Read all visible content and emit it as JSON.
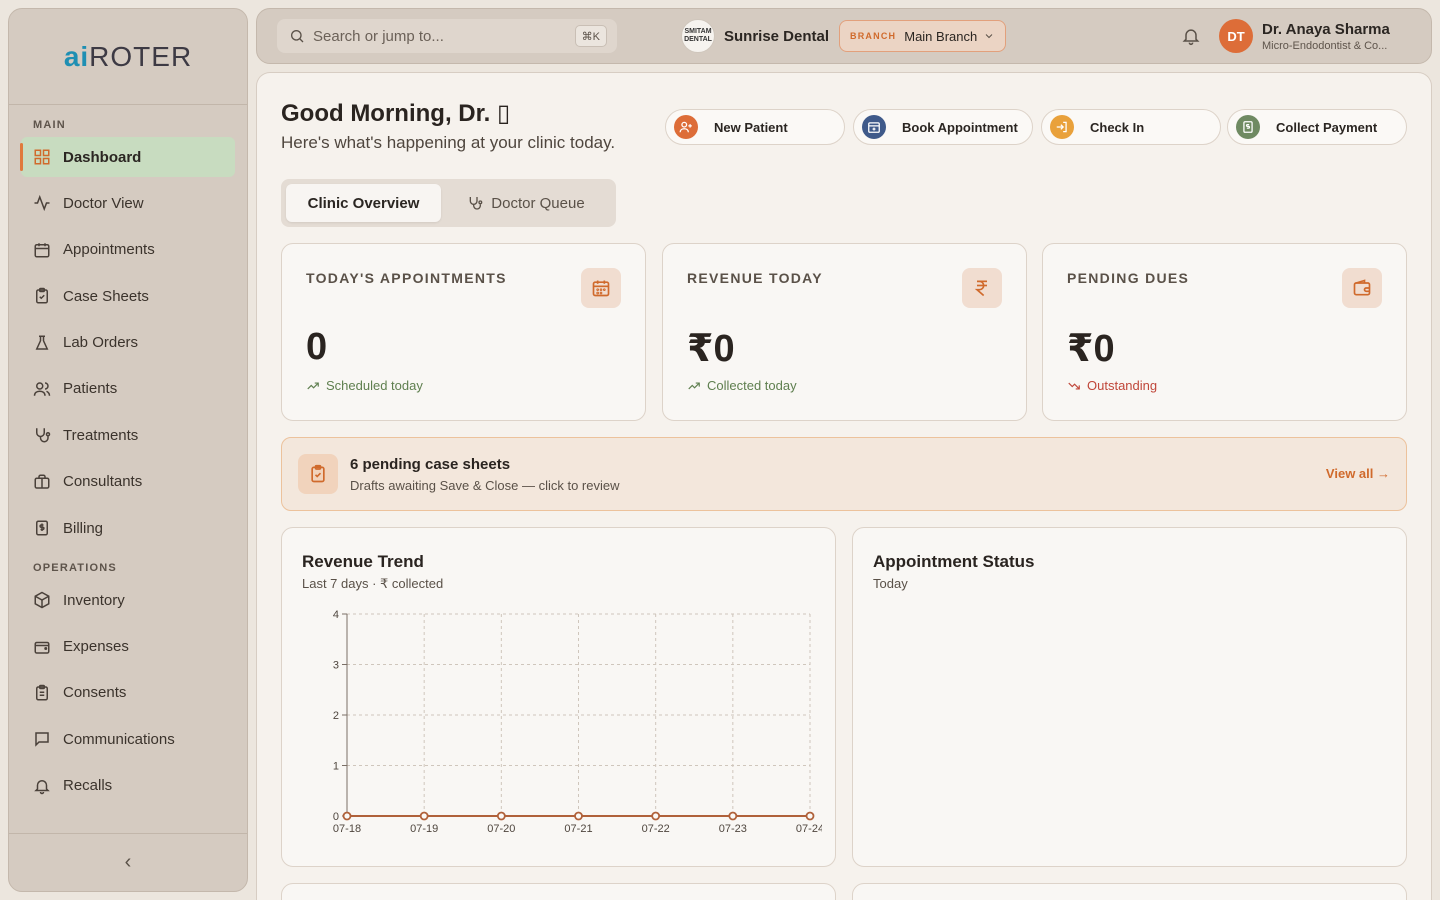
{
  "app": {
    "logo_ai": "ai",
    "logo_rest": "ROTER"
  },
  "sidebar": {
    "section_main": "MAIN",
    "section_ops": "OPERATIONS",
    "items": [
      {
        "label": "Dashboard",
        "icon": "dashboard-icon"
      },
      {
        "label": "Doctor View",
        "icon": "activity-icon"
      },
      {
        "label": "Appointments",
        "icon": "calendar-icon"
      },
      {
        "label": "Case Sheets",
        "icon": "clipboard-icon"
      },
      {
        "label": "Lab Orders",
        "icon": "flask-icon"
      },
      {
        "label": "Patients",
        "icon": "users-icon"
      },
      {
        "label": "Treatments",
        "icon": "stethoscope-icon"
      },
      {
        "label": "Consultants",
        "icon": "briefcase-icon"
      },
      {
        "label": "Billing",
        "icon": "receipt-icon"
      }
    ],
    "ops_items": [
      {
        "label": "Inventory",
        "icon": "package-icon"
      },
      {
        "label": "Expenses",
        "icon": "wallet-icon"
      },
      {
        "label": "Consents",
        "icon": "clipboard-list-icon"
      },
      {
        "label": "Communications",
        "icon": "message-icon"
      },
      {
        "label": "Recalls",
        "icon": "bell-icon"
      }
    ],
    "collapse_glyph": "‹"
  },
  "topbar": {
    "search_placeholder": "Search or jump to...",
    "shortcut": "⌘K",
    "clinic_logo_text": "SMITAM DENTAL",
    "clinic_name": "Sunrise Dental",
    "branch_tag": "BRANCH",
    "branch_name": "Main Branch",
    "avatar_initials": "DT",
    "user_name": "Dr. Anaya Sharma",
    "user_role": "Micro-Endodontist & Co..."
  },
  "main": {
    "greeting": "Good Morning, Dr. ▯",
    "subtitle": "Here's what's happening at your clinic today.",
    "quick_actions": [
      {
        "label": "New Patient",
        "icon": "user-plus-icon",
        "color": "#dd6d38"
      },
      {
        "label": "Book Appointment",
        "icon": "calendar-plus-icon",
        "color": "#3f5a8a"
      },
      {
        "label": "Check In",
        "icon": "login-icon",
        "color": "#e9a13b"
      },
      {
        "label": "Collect Payment",
        "icon": "receipt-icon",
        "color": "#6f8a62"
      }
    ],
    "tabs": [
      {
        "label": "Clinic Overview"
      },
      {
        "label": "Doctor Queue"
      }
    ],
    "stats": [
      {
        "title": "TODAY'S APPOINTMENTS",
        "value": "0",
        "foot": "Scheduled today",
        "trend": "up",
        "icon": "calendar-icon"
      },
      {
        "title": "REVENUE TODAY",
        "value": "₹0",
        "foot": "Collected today",
        "trend": "up",
        "icon": "rupee-icon"
      },
      {
        "title": "PENDING DUES",
        "value": "₹0",
        "foot": "Outstanding",
        "trend": "down",
        "icon": "wallet-icon"
      }
    ],
    "banner": {
      "title": "6 pending case sheets",
      "subtitle": "Drafts awaiting Save & Close — click to review",
      "link": "View all →"
    },
    "revenue_panel": {
      "title": "Revenue Trend",
      "subtitle": "Last 7 days · ₹ collected"
    },
    "status_panel": {
      "title": "Appointment Status",
      "subtitle": "Today"
    }
  },
  "colors": {
    "accent": "#dd6d38",
    "trend_up": "#5f7f4f",
    "trend_down": "#c0473a",
    "line": "#b0613a"
  },
  "chart_data": {
    "type": "line",
    "x": [
      "07-18",
      "07-19",
      "07-20",
      "07-21",
      "07-22",
      "07-23",
      "07-24"
    ],
    "series": [
      {
        "values": [
          0,
          0,
          0,
          0,
          0,
          0,
          0
        ]
      }
    ],
    "yticks": [
      0,
      1,
      2,
      3,
      4
    ],
    "ylim": [
      0,
      4
    ],
    "grid": true
  }
}
